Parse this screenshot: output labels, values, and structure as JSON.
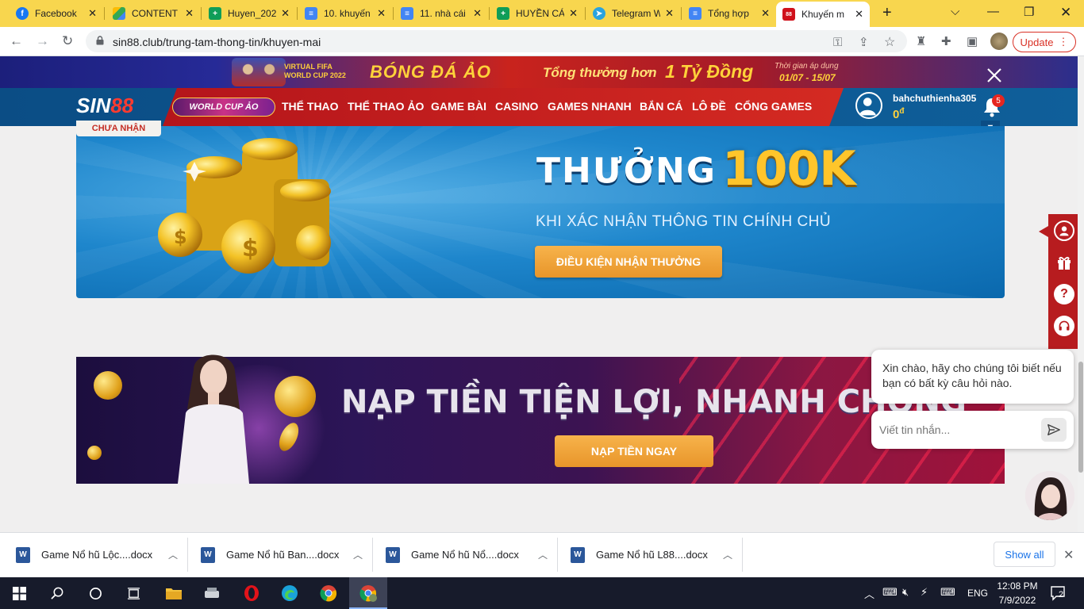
{
  "browser": {
    "tabs": [
      {
        "label": "Facebook",
        "icon": "facebook-icon",
        "color": "#1877f2"
      },
      {
        "label": "CONTENT",
        "icon": "google-drive-icon",
        "color": "#34a853"
      },
      {
        "label": "Huyen_202",
        "icon": "google-sheets-icon",
        "color": "#0f9d58"
      },
      {
        "label": "10. khuyến",
        "icon": "google-docs-icon",
        "color": "#4285f4"
      },
      {
        "label": "11. nhà cái",
        "icon": "google-docs-icon",
        "color": "#4285f4"
      },
      {
        "label": "HUYỀN CÁ",
        "icon": "google-sheets-icon",
        "color": "#0f9d58"
      },
      {
        "label": "Telegram W",
        "icon": "telegram-icon",
        "color": "#2aa3df"
      },
      {
        "label": "Tổng hợp",
        "icon": "google-docs-icon",
        "color": "#4285f4"
      },
      {
        "label": "Khuyến m",
        "icon": "sin88-favicon",
        "color": "#d0111b"
      }
    ],
    "url": "sin88.club/trung-tam-thong-tin/khuyen-mai",
    "update_label": "Update"
  },
  "promo": {
    "line1": "VIRTUAL FIFA",
    "line2": "WORLD CUP 2022",
    "headline": "BÓNG ĐÁ ẢO",
    "prize_text": "Tổng thưởng hơn",
    "prize_amount": "1 Tỷ Đồng",
    "period_label": "Thời gian áp dụng",
    "period": "01/07 - 15/07"
  },
  "site": {
    "logo_main": "SIN",
    "logo_num": "88",
    "badge": "WORLD CUP ẢO",
    "nav": [
      "THỂ THAO",
      "THỂ THAO ẢO",
      "GAME BÀI",
      "CASINO",
      "GAMES NHANH",
      "BẮN CÁ",
      "LÔ ĐỀ",
      "CỔNG GAMES"
    ],
    "username": "bahchuthienha305",
    "balance": "0",
    "currency": "đ",
    "notifications": "5"
  },
  "card1": {
    "status_tag": "CHƯA NHẬN",
    "title": "THƯỞNG",
    "amount": "100K",
    "subtitle": "KHI XÁC NHẬN THÔNG TIN CHÍNH CHỦ",
    "button": "ĐIỀU KIỆN NHẬN THƯỞNG"
  },
  "card2": {
    "title": "NẠP TIỀN TIỆN LỢI, NHANH CHÓNG",
    "button": "NẠP TIỀN NGAY"
  },
  "chat": {
    "greeting": "Xin chào, hãy cho chúng tôi biết nếu bạn có bất kỳ câu hỏi nào.",
    "placeholder": "Viết tin nhắn..."
  },
  "downloads": {
    "items": [
      "Game Nổ hũ Lộc....docx",
      "Game Nổ hũ Ban....docx",
      "Game Nổ hũ Nổ....docx",
      "Game Nổ hũ L88....docx"
    ],
    "show_all": "Show all"
  },
  "taskbar": {
    "language": "ENG",
    "time": "12:08 PM",
    "date": "7/9/2022",
    "notification_count": "2"
  }
}
